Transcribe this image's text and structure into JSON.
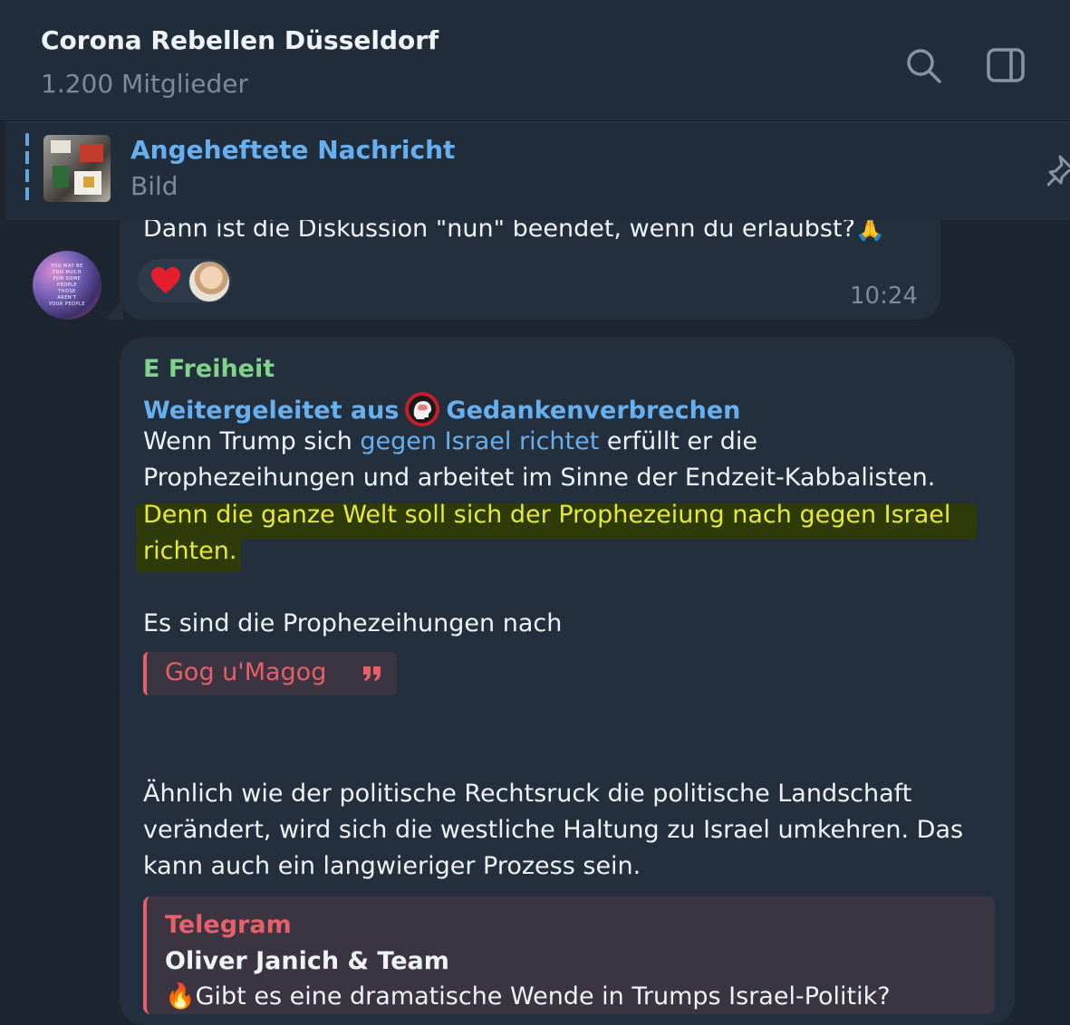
{
  "header": {
    "title": "Corona Rebellen Düsseldorf",
    "subtitle": "1.200 Mitglieder",
    "search_icon": "search-icon",
    "panel_icon": "sidebar-toggle-icon"
  },
  "pinned": {
    "title": "Angeheftete Nachricht",
    "subtitle": "Bild",
    "icon": "pin-icon"
  },
  "prev_message": {
    "text": "Dann ist die Diskussion \"nun\" beendet, wenn du erlaubst?🙏",
    "reactions": [
      "❤️"
    ],
    "time": "10:24"
  },
  "message": {
    "sender": "E Freiheit",
    "forwarded_prefix": "Weitergeleitet aus",
    "forwarded_from": "Gedankenverbrechen",
    "p1_a": "Wenn Trump sich ",
    "p1_link": "gegen Israel richtet",
    "p1_b": " erfüllt er die",
    "p1_line2": "Prophezeihungen und arbeitet im Sinne der Endzeit-Kabbalisten.",
    "highlight_line1": "Denn die ganze Welt soll sich der Prophezeiung nach gegen Israel",
    "highlight_line2": "richten.",
    "p2": "Es sind die Prophezeihungen nach",
    "quote_chip": "Gog u'Magog",
    "p3_line1": "Ähnlich wie der politische  Rechtsruck die politische Landschaft",
    "p3_line2": "verändert, wird sich die westliche Haltung zu Israel umkehren. Das",
    "p3_line3": "kann auch ein langwieriger Prozess sein."
  },
  "link_preview": {
    "site": "Telegram",
    "title": "Oliver Janich & Team",
    "description": "🔥Gibt es eine dramatische Wende in Trumps Israel-Politik?"
  },
  "colors": {
    "background": "#1c2530",
    "bubble": "#242f3d",
    "accent_blue": "#66b0f0",
    "sender_green": "#7fd38a",
    "highlight_yellow": "#e7ea35",
    "quote_red": "#e6606b"
  }
}
